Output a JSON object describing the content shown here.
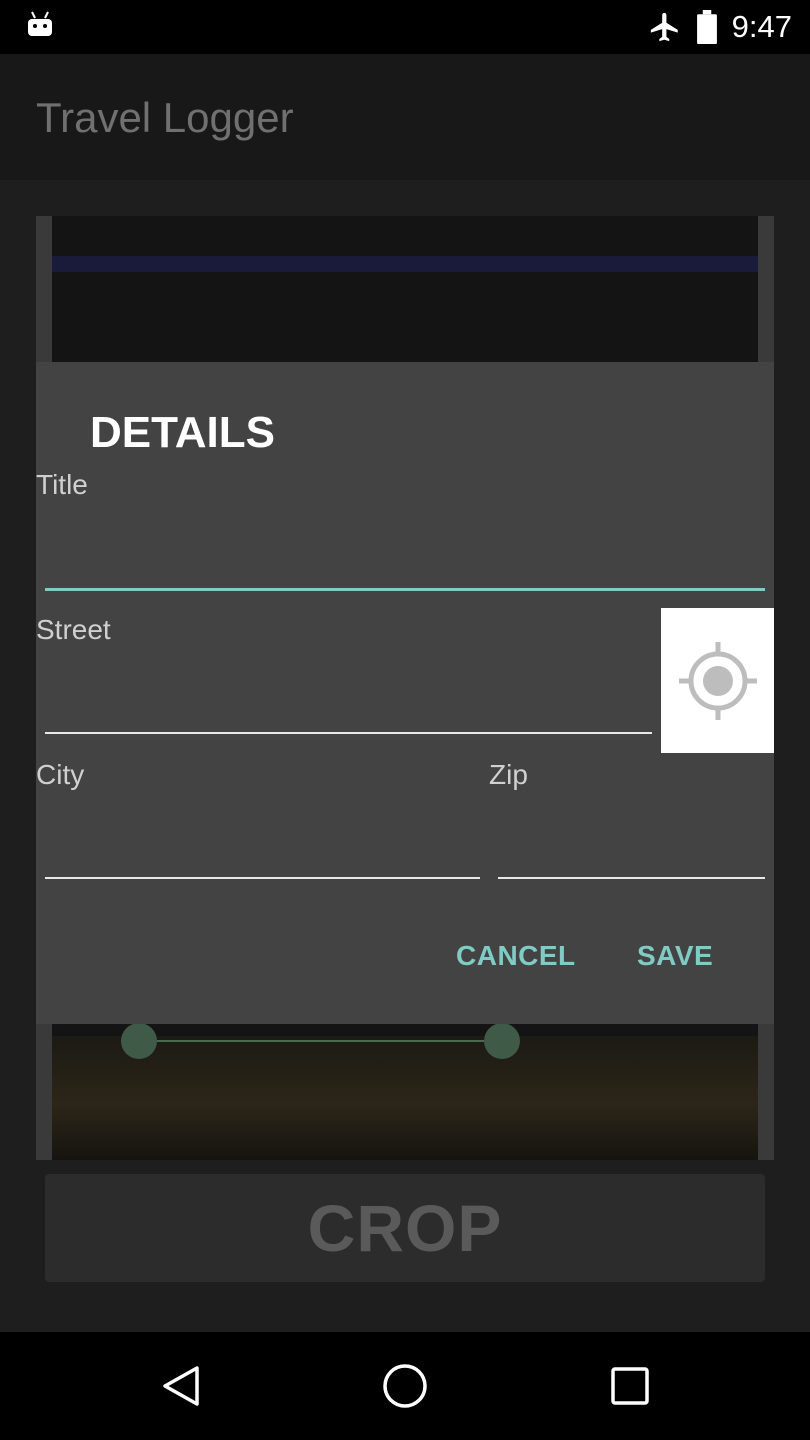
{
  "status_bar": {
    "time": "9:47",
    "icons": [
      "android-notification-icon",
      "airplane-icon",
      "battery-icon"
    ]
  },
  "app": {
    "title": "Travel Logger",
    "crop_label": "CROP"
  },
  "dialog": {
    "title": "DETAILS",
    "fields": {
      "title": {
        "label": "Title",
        "value": ""
      },
      "street": {
        "label": "Street",
        "value": ""
      },
      "city": {
        "label": "City",
        "value": ""
      },
      "zip": {
        "label": "Zip",
        "value": ""
      }
    },
    "locate_icon": "my-location-icon",
    "cancel_label": "CANCEL",
    "save_label": "SAVE",
    "accent_color": "#80cbc4"
  },
  "nav_bar": {
    "icons": [
      "back-icon",
      "home-icon",
      "recents-icon"
    ]
  }
}
